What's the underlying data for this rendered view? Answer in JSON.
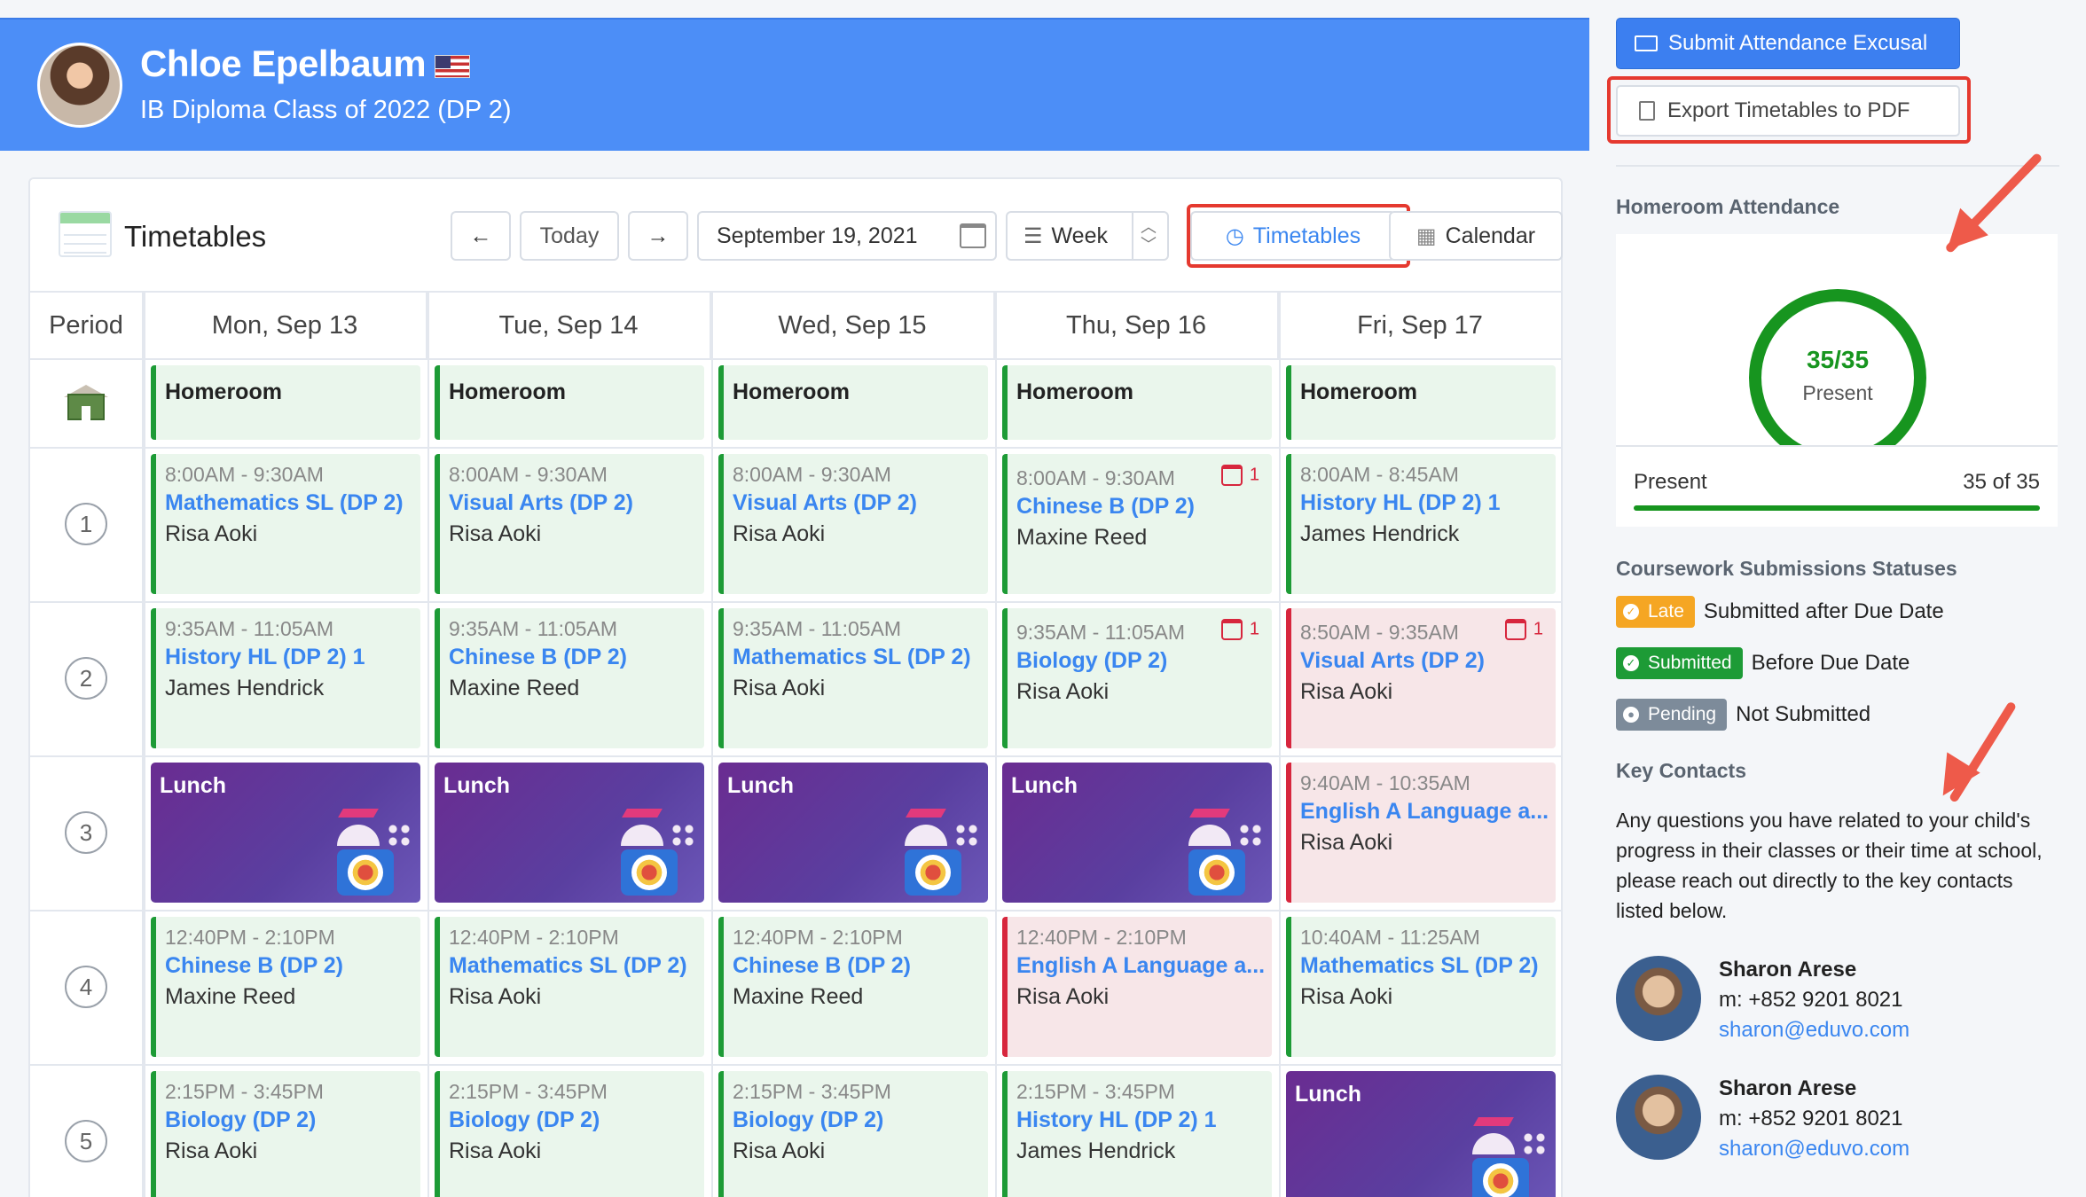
{
  "student": {
    "name": "Chloe Epelbaum",
    "class": "IB Diploma Class of 2022 (DP 2)"
  },
  "toolbar": {
    "title": "Timetables",
    "prev": "←",
    "today": "Today",
    "next": "→",
    "date": "September 19, 2021",
    "view": "Week",
    "timetables": "Timetables",
    "calendar": "Calendar"
  },
  "grid": {
    "period_header": "Period",
    "days": [
      "Mon, Sep 13",
      "Tue, Sep 14",
      "Wed, Sep 15",
      "Thu, Sep 16",
      "Fri, Sep 17"
    ],
    "periods": [
      "1",
      "2",
      "3",
      "4",
      "5"
    ],
    "homeroom": "Homeroom",
    "lunch": "Lunch",
    "rows": [
      [
        {
          "time": "8:00AM - 9:30AM",
          "subject": "Mathematics SL (DP 2)",
          "teacher": "Risa Aoki"
        },
        {
          "time": "8:00AM - 9:30AM",
          "subject": "Visual Arts (DP 2)",
          "teacher": "Risa Aoki"
        },
        {
          "time": "8:00AM - 9:30AM",
          "subject": "Visual Arts (DP 2)",
          "teacher": "Risa Aoki"
        },
        {
          "time": "8:00AM - 9:30AM",
          "subject": "Chinese B (DP 2)",
          "teacher": "Maxine Reed",
          "badge": "1"
        },
        {
          "time": "8:00AM - 8:45AM",
          "subject": "History HL (DP 2) 1",
          "teacher": "James Hendrick"
        }
      ],
      [
        {
          "time": "9:35AM - 11:05AM",
          "subject": "History HL (DP 2) 1",
          "teacher": "James Hendrick"
        },
        {
          "time": "9:35AM - 11:05AM",
          "subject": "Chinese B (DP 2)",
          "teacher": "Maxine Reed"
        },
        {
          "time": "9:35AM - 11:05AM",
          "subject": "Mathematics SL (DP 2)",
          "teacher": "Risa Aoki"
        },
        {
          "time": "9:35AM - 11:05AM",
          "subject": "Biology (DP 2)",
          "teacher": "Risa Aoki",
          "badge": "1"
        },
        {
          "time": "8:50AM - 9:35AM",
          "subject": "Visual Arts (DP 2)",
          "teacher": "Risa Aoki",
          "badge": "1",
          "status": "red"
        }
      ],
      [
        {
          "lunch": true
        },
        {
          "lunch": true
        },
        {
          "lunch": true
        },
        {
          "lunch": true
        },
        {
          "time": "9:40AM - 10:35AM",
          "subject": "English A Language a...",
          "teacher": "Risa Aoki",
          "status": "red"
        }
      ],
      [
        {
          "time": "12:40PM - 2:10PM",
          "subject": "Chinese B (DP 2)",
          "teacher": "Maxine Reed"
        },
        {
          "time": "12:40PM - 2:10PM",
          "subject": "Mathematics SL (DP 2)",
          "teacher": "Risa Aoki"
        },
        {
          "time": "12:40PM - 2:10PM",
          "subject": "Chinese B (DP 2)",
          "teacher": "Maxine Reed"
        },
        {
          "time": "12:40PM - 2:10PM",
          "subject": "English A Language a...",
          "teacher": "Risa Aoki",
          "status": "red"
        },
        {
          "time": "10:40AM - 11:25AM",
          "subject": "Mathematics SL (DP 2)",
          "teacher": "Risa Aoki"
        }
      ],
      [
        {
          "time": "2:15PM - 3:45PM",
          "subject": "Biology (DP 2)",
          "teacher": "Risa Aoki"
        },
        {
          "time": "2:15PM - 3:45PM",
          "subject": "Biology (DP 2)",
          "teacher": "Risa Aoki"
        },
        {
          "time": "2:15PM - 3:45PM",
          "subject": "Biology (DP 2)",
          "teacher": "Risa Aoki"
        },
        {
          "time": "2:15PM - 3:45PM",
          "subject": "History HL (DP 2) 1",
          "teacher": "James Hendrick"
        },
        {
          "lunch": true
        }
      ]
    ]
  },
  "sidebar": {
    "excusal": "Submit Attendance Excusal",
    "export": "Export Timetables to PDF",
    "attendance_heading": "Homeroom Attendance",
    "ring_value": "35/35",
    "ring_label": "Present",
    "present_label": "Present",
    "present_count": "35 of 35",
    "present_fraction": 1.0,
    "coursework_heading": "Coursework Submissions Statuses",
    "statuses": [
      {
        "pill": "Late",
        "desc": "Submitted after Due Date"
      },
      {
        "pill": "Submitted",
        "desc": "Before Due Date"
      },
      {
        "pill": "Pending",
        "desc": "Not Submitted"
      }
    ],
    "contacts_heading": "Key Contacts",
    "contacts_text": "Any questions you have related to your child's progress in their classes or their time at school, please reach out directly to the key contacts listed below.",
    "contacts": [
      {
        "name": "Sharon Arese",
        "phone": "m: +852 9201 8021",
        "email": "sharon@eduvo.com"
      },
      {
        "name": "Sharon Arese",
        "phone": "m: +852 9201 8021",
        "email": "sharon@eduvo.com"
      }
    ]
  },
  "colors": {
    "header_blue": "#4c8ef7",
    "link_blue": "#3a86f0",
    "green": "#1d9b36",
    "red": "#d7263d",
    "annotation_red": "#e5392f",
    "lunch_purple": "#5a3fa0"
  }
}
